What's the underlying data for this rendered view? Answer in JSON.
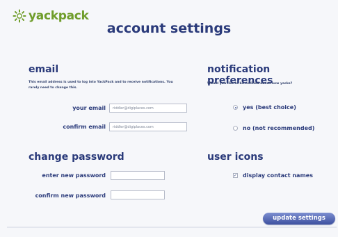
{
  "brand": {
    "name": "yackpack",
    "accent": "#6f9d2a",
    "primary": "#2a3a7a"
  },
  "page": {
    "title": "account settings"
  },
  "email": {
    "heading": "email",
    "description": "This email address is used to log into YackPack and to receive notifications. You rarely need to change this.",
    "your_email_label": "your email",
    "your_email_value": "riddler@digiplaces.com",
    "confirm_email_label": "confirm email",
    "confirm_email_value": "riddler@digiplaces.com"
  },
  "password": {
    "heading": "change password",
    "new_label": "enter new password",
    "confirm_label": "confirm new password"
  },
  "notifications": {
    "heading": "notification preferences",
    "question": "Would you like to be notified about new yacks?",
    "options": [
      {
        "label": "yes  (best choice)",
        "selected": true
      },
      {
        "label": "no   (not recommended)",
        "selected": false
      }
    ]
  },
  "user_icons": {
    "heading": "user icons",
    "display_contact_names_label": "display contact names",
    "display_contact_names_checked": true
  },
  "actions": {
    "update_label": "update settings"
  }
}
